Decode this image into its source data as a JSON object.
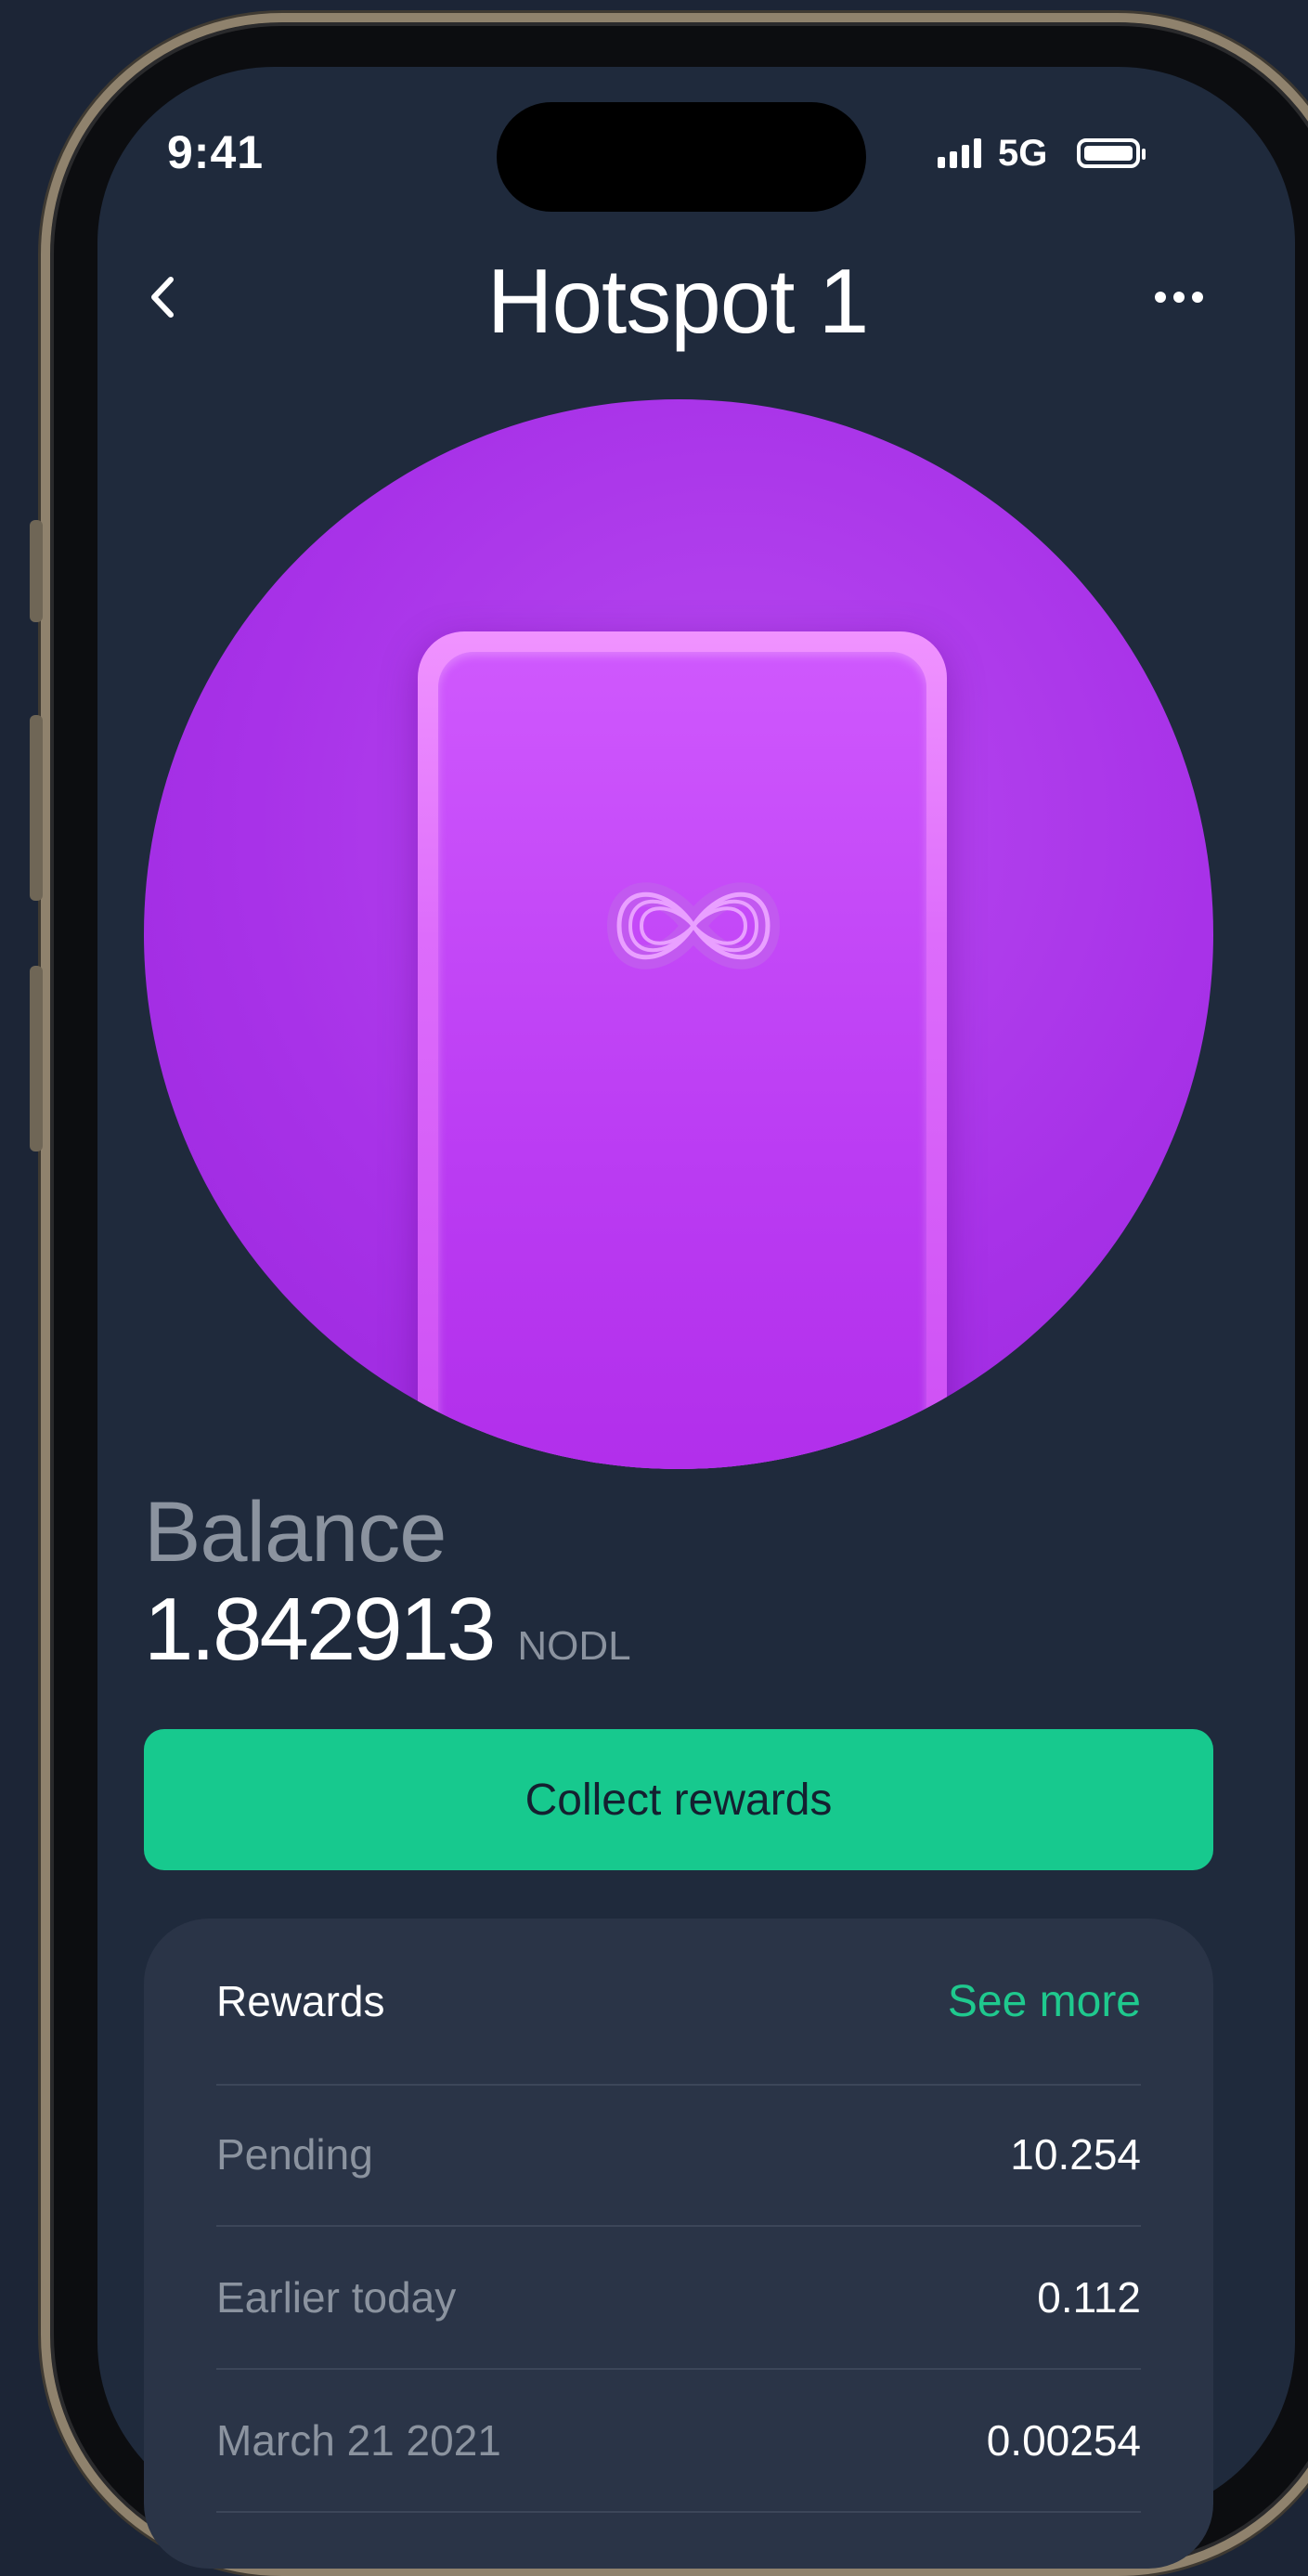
{
  "status_bar": {
    "time": "9:41",
    "network": "5G",
    "icons": [
      "signal-icon",
      "battery-icon"
    ]
  },
  "header": {
    "title": "Hotspot 1",
    "back_icon": "chevron-left-icon",
    "more_icon": "more-horizontal-icon"
  },
  "hero": {
    "image": "purple hotspot device with infinity logo",
    "colors": {
      "circle": "#a832e8",
      "device": "#c845f2"
    }
  },
  "balance": {
    "label": "Balance",
    "amount": "1.842913",
    "unit": "NODL"
  },
  "actions": {
    "collect_label": "Collect rewards",
    "collect_color": "#17c98e"
  },
  "rewards": {
    "title": "Rewards",
    "see_more_label": "See more",
    "items": [
      {
        "label": "Pending",
        "value": "10.254"
      },
      {
        "label": "Earlier today",
        "value": "0.112"
      },
      {
        "label": "March 21 2021",
        "value": "0.00254"
      }
    ]
  },
  "theme": {
    "background": "#1f2a3c",
    "card": "#2a3447",
    "accent": "#1fc98e",
    "muted_text": "#8b939f"
  }
}
